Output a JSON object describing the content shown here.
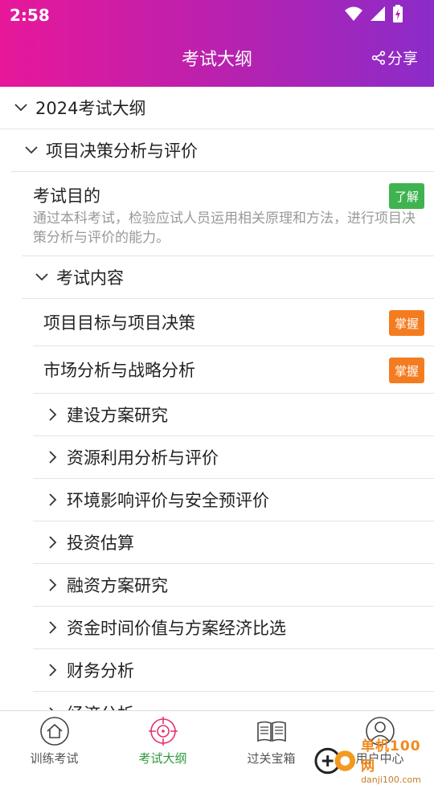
{
  "status_bar": {
    "time": "2:58"
  },
  "header": {
    "title": "考试大纲",
    "share_label": "分享"
  },
  "outline": {
    "root": "2024考试大纲",
    "section": "项目决策分析与评价",
    "purpose": {
      "title": "考试目的",
      "badge": "了解",
      "description": "通过本科考试，检验应试人员运用相关原理和方法，进行项目决策分析与评价的能力。"
    },
    "content_header": "考试内容",
    "mastery_items": [
      {
        "label": "项目目标与项目决策",
        "badge": "掌握"
      },
      {
        "label": "市场分析与战略分析",
        "badge": "掌握"
      }
    ],
    "chapters": [
      "建设方案研究",
      "资源利用分析与评价",
      "环境影响评价与安全预评价",
      "投资估算",
      "融资方案研究",
      "资金时间价值与方案经济比选",
      "财务分析",
      "经济分析"
    ]
  },
  "colors": {
    "badge_learn": "#3fb34f",
    "badge_master": "#f47c20",
    "active_tab": "#2e9a3e"
  },
  "tabbar": [
    {
      "label": "训练考试",
      "icon": "home-icon"
    },
    {
      "label": "考试大纲",
      "icon": "target-icon",
      "active": true
    },
    {
      "label": "过关宝箱",
      "icon": "book-icon"
    },
    {
      "label": "用户中心",
      "icon": "user-icon"
    }
  ],
  "watermark": {
    "text": "单机100网",
    "sub": "danji100.com"
  }
}
